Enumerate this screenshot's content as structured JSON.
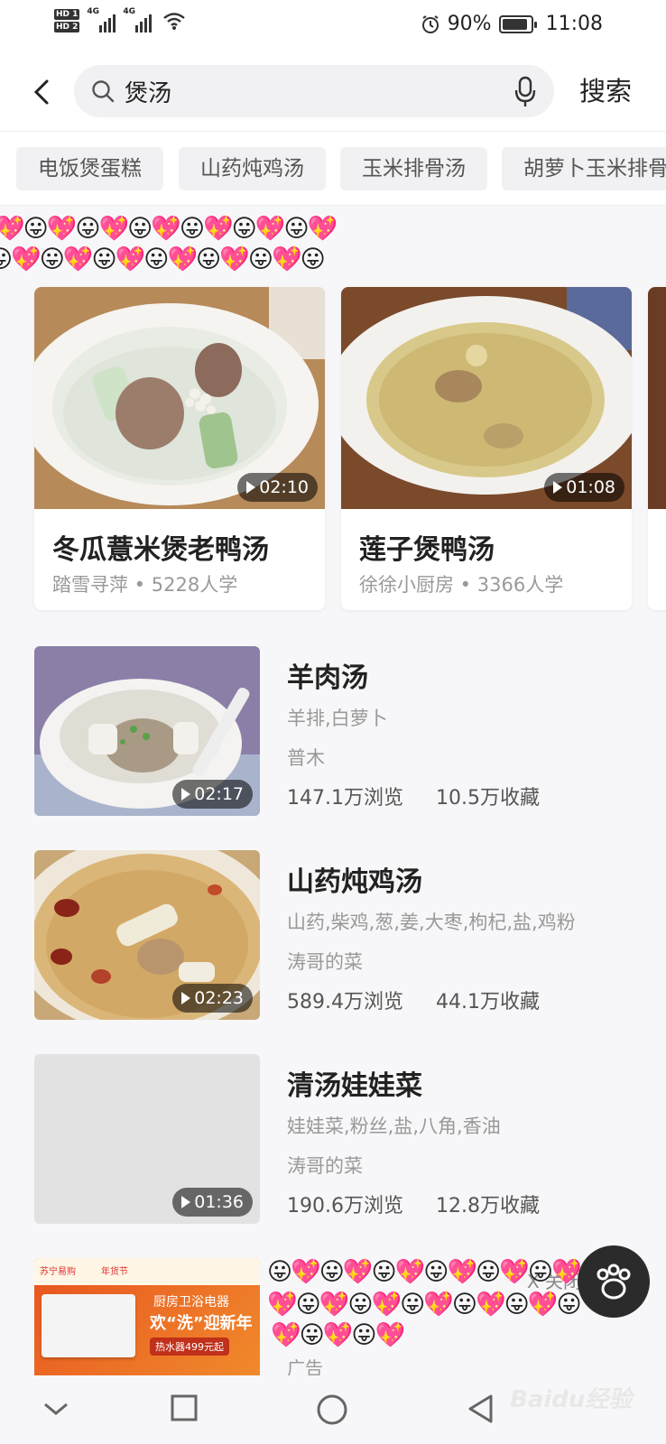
{
  "status_bar": {
    "hd1": "HD 1",
    "hd2": "HD 2",
    "net1": "4G",
    "net2": "4G",
    "battery": "90%",
    "battery_level": 0.9,
    "time": "11:08"
  },
  "search": {
    "query": "煲汤",
    "submit_label": "搜索"
  },
  "tags": [
    "电饭煲蛋糕",
    "山药炖鸡汤",
    "玉米排骨汤",
    "胡萝卜玉米排骨"
  ],
  "emoji": {
    "row_a": "💖😛💖😛💖😛💖😛💖😛💖😛💖",
    "row_b": "😛💖😛💖😛💖😛💖😛💖😛💖😛",
    "row_c": "😛💖😛💖😛💖😛💖😛💖😛💖😛",
    "row_d": "💖😛💖😛💖😛💖😛💖😛💖😛",
    "row_e": "💖😛💖😛💖"
  },
  "featured": [
    {
      "title": "冬瓜薏米煲老鸭汤",
      "author": "踏雪寻萍",
      "learners": "5228人学",
      "duration": "02:10"
    },
    {
      "title": "莲子煲鸭汤",
      "author": "徐徐小厨房",
      "learners": "3366人学",
      "duration": "01:08"
    }
  ],
  "recipes": [
    {
      "name": "羊肉汤",
      "ingredients": "羊排,白萝卜",
      "author": "普木",
      "views": "147.1万浏览",
      "favorites": "10.5万收藏",
      "duration": "02:17"
    },
    {
      "name": "山药炖鸡汤",
      "ingredients": "山药,柴鸡,葱,姜,大枣,枸杞,盐,鸡粉",
      "author": "涛哥的菜",
      "views": "589.4万浏览",
      "favorites": "44.1万收藏",
      "duration": "02:23"
    },
    {
      "name": "清汤娃娃菜",
      "ingredients": "娃娃菜,粉丝,盐,八角,香油",
      "author": "涛哥的菜",
      "views": "190.6万浏览",
      "favorites": "12.8万收藏",
      "duration": "01:36"
    }
  ],
  "ad": {
    "brand": "苏宁易购",
    "festival": "年货节",
    "line1": "厨房卫浴电器",
    "line2": "欢“洗”迎新年",
    "line3": "热水器499元起",
    "label": "广告",
    "close": "X 关闭"
  },
  "watermark": "Baidu经验"
}
